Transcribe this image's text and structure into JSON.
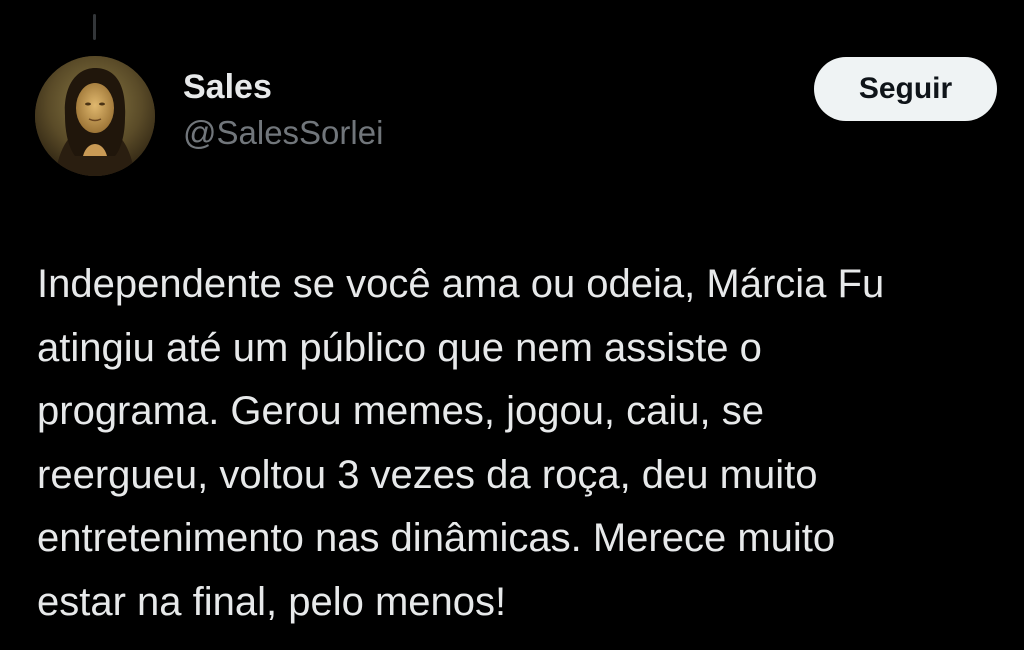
{
  "author": {
    "display_name": "Sales",
    "handle": "@SalesSorlei"
  },
  "follow_button": {
    "label": "Seguir"
  },
  "tweet": {
    "lines": [
      "Independente se você ama ou odeia, Márcia Fu",
      "atingiu até um público que nem assiste o",
      "programa. Gerou memes, jogou, caiu, se",
      "reergueu, voltou 3 vezes da roça, deu muito",
      "entretenimento nas dinâmicas. Merece muito",
      "estar na final, pelo menos!"
    ]
  },
  "colors": {
    "background": "#000000",
    "primary_text": "#e7e9ea",
    "secondary_text": "#71767b",
    "button_background": "#eff3f4",
    "button_text": "#0f1419"
  }
}
